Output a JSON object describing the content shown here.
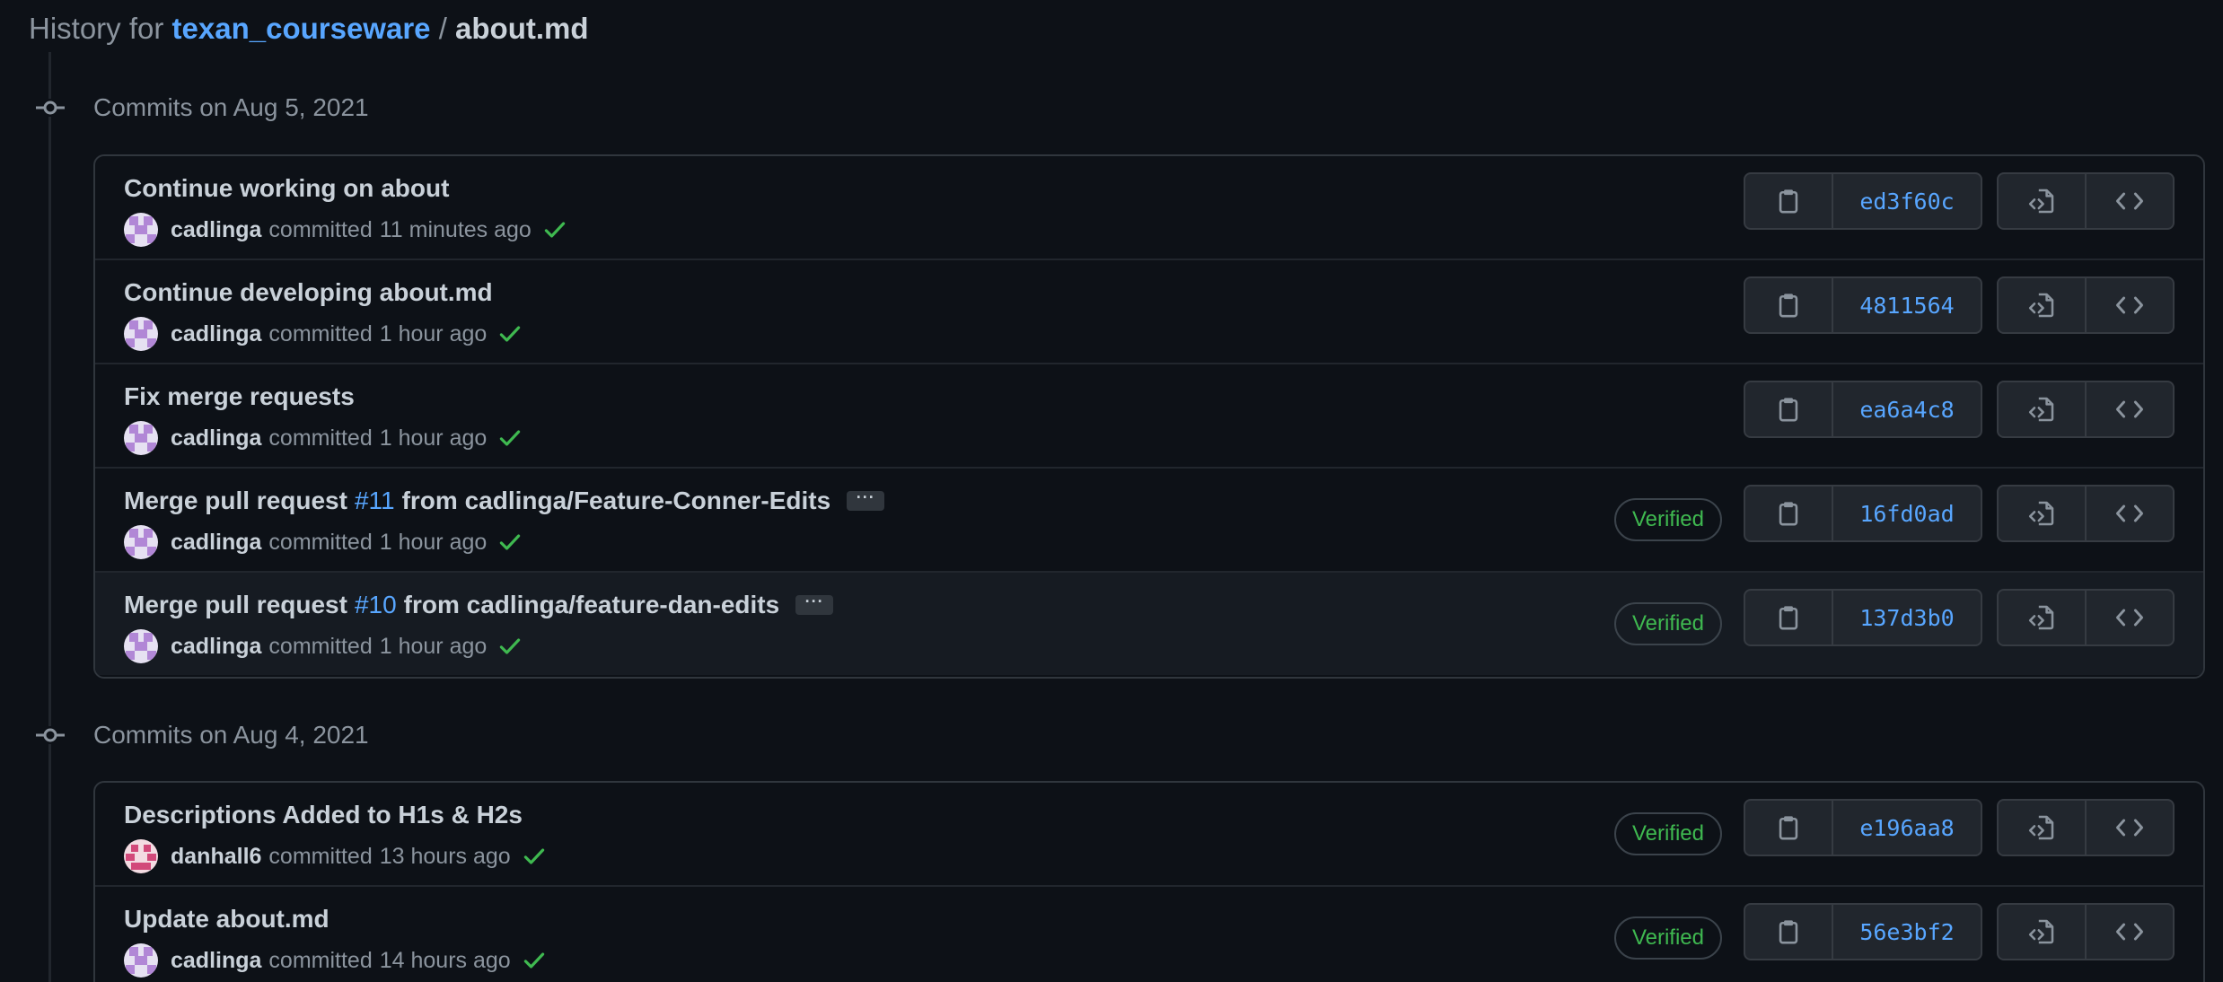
{
  "header": {
    "prefix": "History for",
    "repo": "texan_courseware",
    "separator": "/",
    "file": "about.md"
  },
  "groups": [
    {
      "label": "Commits on Aug 5, 2021",
      "commits": [
        {
          "message": "Continue working on about",
          "author": "cadlinga",
          "action": "committed",
          "time": "11 minutes ago",
          "verified": "",
          "sha": "ed3f60c"
        },
        {
          "message": "Continue developing about.md",
          "author": "cadlinga",
          "action": "committed",
          "time": "1 hour ago",
          "verified": "",
          "sha": "4811564"
        },
        {
          "message": "Fix merge requests",
          "author": "cadlinga",
          "action": "committed",
          "time": "1 hour ago",
          "verified": "",
          "sha": "ea6a4c8"
        },
        {
          "message_prefix": "Merge pull request",
          "pr": "#11",
          "message_suffix": "from cadlinga/Feature-Conner-Edits",
          "ellipsis": "···",
          "author": "cadlinga",
          "action": "committed",
          "time": "1 hour ago",
          "verified": "Verified",
          "sha": "16fd0ad"
        },
        {
          "message_prefix": "Merge pull request",
          "pr": "#10",
          "message_suffix": "from cadlinga/feature-dan-edits",
          "ellipsis": "···",
          "author": "cadlinga",
          "action": "committed",
          "time": "1 hour ago",
          "verified": "Verified",
          "sha": "137d3b0"
        }
      ]
    },
    {
      "label": "Commits on Aug 4, 2021",
      "commits": [
        {
          "message": "Descriptions Added to H1s & H2s",
          "author": "danhall6",
          "action": "committed",
          "time": "13 hours ago",
          "verified": "Verified",
          "sha": "e196aa8"
        },
        {
          "message": "Update about.md",
          "author": "cadlinga",
          "action": "committed",
          "time": "14 hours ago",
          "verified": "Verified",
          "sha": "56e3bf2"
        }
      ]
    }
  ],
  "colors": {
    "background": "#0d1117",
    "link": "#58a6ff",
    "success": "#3fb950",
    "border": "#30363d"
  },
  "icons": {
    "commit_group": "git-commit-icon",
    "status": "check-icon",
    "copy": "clipboard-icon",
    "browse": "file-code-icon",
    "code": "code-icon"
  }
}
